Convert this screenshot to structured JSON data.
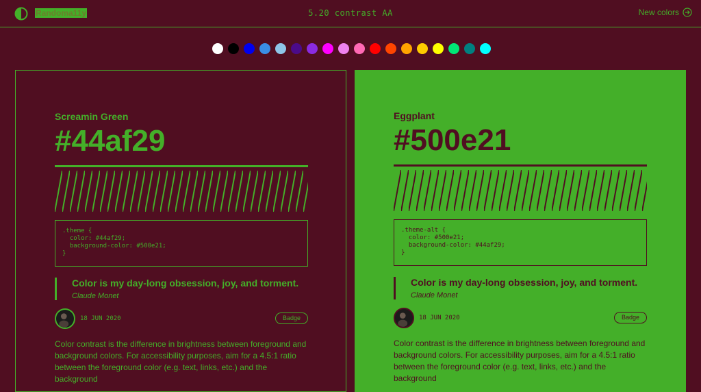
{
  "header": {
    "title": "Randoma11y",
    "contrast_text": "5.20 contrast AA",
    "new_colors_label": "New colors",
    "logo_icon": "half-circle-icon",
    "new_colors_icon": "arrow-circle-right-icon"
  },
  "swatches": [
    "#ffffff",
    "#000000",
    "#0000ee",
    "#3a8ee6",
    "#8ec5e8",
    "#4b0b8a",
    "#8a2be2",
    "#ff00ff",
    "#ee82ee",
    "#ff69b4",
    "#ff0000",
    "#ff4500",
    "#ffa500",
    "#ffcc00",
    "#ffff00",
    "#00e676",
    "#008080",
    "#00ffff"
  ],
  "cards": {
    "left": {
      "name": "Screamin Green",
      "hex": "#44af29",
      "code": ".theme {\n  color: #44af29;\n  background-color: #500e21;\n}",
      "quote": "Color is my day-long obsession, joy, and torment.",
      "author": "Claude Monet",
      "date": "18 JUN 2020",
      "badge": "Badge",
      "body": "Color contrast is the difference in brightness between foreground and background colors. For accessibility purposes, aim for a 4.5:1 ratio between the foreground color (e.g. text, links, etc.) and the background"
    },
    "right": {
      "name": "Eggplant",
      "hex": "#500e21",
      "code": ".theme-alt {\n  color: #500e21;\n  background-color: #44af29;\n}",
      "quote": "Color is my day-long obsession, joy, and torment.",
      "author": "Claude Monet",
      "date": "18 JUN 2020",
      "badge": "Badge",
      "body": "Color contrast is the difference in brightness between foreground and background colors. For accessibility purposes, aim for a 4.5:1 ratio between the foreground color (e.g. text, links, etc.) and the background"
    }
  },
  "colors": {
    "foreground": "#44af29",
    "background": "#500e21"
  }
}
